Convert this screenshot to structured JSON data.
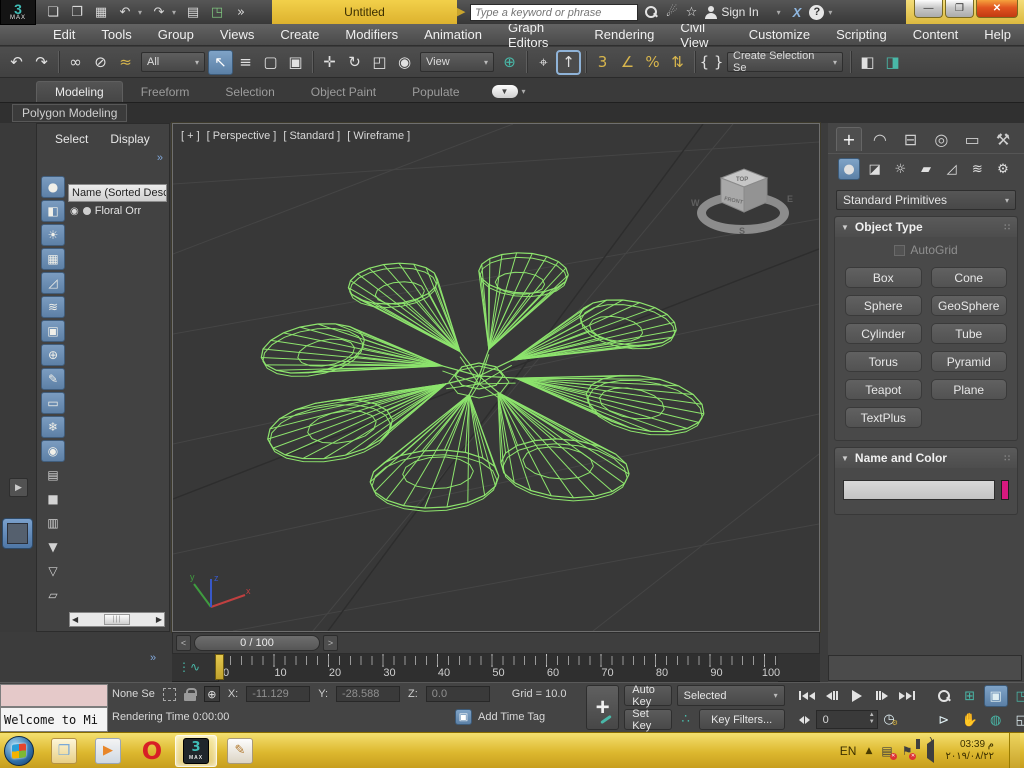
{
  "window": {
    "logo_text": "3",
    "logo_sub": "MAX",
    "title": "Untitled",
    "search_placeholder": "Type a keyword or phrase",
    "sign_in_label": "Sign In",
    "exchange_label": "X",
    "help_label": "?",
    "min_glyph": "—",
    "restore_glyph": "❐",
    "close_glyph": "✕",
    "quick_access": [
      {
        "name": "new-file-icon",
        "glyph": "❏"
      },
      {
        "name": "open-file-icon",
        "glyph": "❐"
      },
      {
        "name": "save-file-icon",
        "glyph": "▦"
      },
      {
        "name": "undo-icon",
        "glyph": "↶",
        "caret": true
      },
      {
        "name": "redo-icon",
        "glyph": "↷",
        "caret": true
      },
      {
        "name": "project-folder-icon",
        "glyph": "▤"
      },
      {
        "name": "workspace-icon",
        "glyph": "◳",
        "green": true
      },
      {
        "name": "overflow-icon",
        "glyph": "»"
      }
    ]
  },
  "menu_bar": {
    "items": [
      "Edit",
      "Tools",
      "Group",
      "Views",
      "Create",
      "Modifiers",
      "Animation",
      "Graph Editors",
      "Rendering",
      "Civil View",
      "Customize",
      "Scripting",
      "Content",
      "Help"
    ]
  },
  "toolbar": {
    "selection_filter_value": "All",
    "reference_coord_value": "View",
    "named_selection_value": "Create Selection Se",
    "groups": {
      "history": [
        {
          "name": "undo-icon",
          "glyph": "↶"
        },
        {
          "name": "redo-icon",
          "glyph": "↷"
        }
      ],
      "linking": [
        {
          "name": "select-and-link-icon",
          "glyph": "∞"
        },
        {
          "name": "unlink-selection-icon",
          "glyph": "⊘"
        },
        {
          "name": "bind-to-spacewarp-icon",
          "glyph": "≈",
          "gold": true
        }
      ],
      "selection": [
        {
          "name": "select-object-icon",
          "glyph": "↖",
          "active": true
        },
        {
          "name": "select-by-name-icon",
          "glyph": "≡"
        },
        {
          "name": "rectangular-selection-region-icon",
          "glyph": "▢"
        },
        {
          "name": "window-crossing-icon",
          "glyph": "▣"
        }
      ],
      "transform": [
        {
          "name": "select-and-move-icon",
          "glyph": "✛"
        },
        {
          "name": "select-and-rotate-icon",
          "glyph": "↻"
        },
        {
          "name": "select-and-scale-icon",
          "glyph": "◰"
        },
        {
          "name": "select-and-place-icon",
          "glyph": "◉"
        }
      ],
      "pivot": [
        {
          "name": "use-pivot-point-center-icon",
          "glyph": "⊕",
          "teal": true
        }
      ],
      "manipulate": [
        {
          "name": "select-and-manipulate-icon",
          "glyph": "⌖"
        },
        {
          "name": "keyboard-shortcut-override-icon",
          "glyph": "↑",
          "outlined": true
        }
      ],
      "snaps": [
        {
          "name": "snaps-toggle-3d-icon",
          "glyph": "3",
          "gold": true
        },
        {
          "name": "angle-snap-icon",
          "glyph": "∠",
          "gold": true
        },
        {
          "name": "percent-snap-icon",
          "glyph": "%",
          "gold": true
        },
        {
          "name": "spinner-snap-icon",
          "glyph": "⇅",
          "gold": true
        }
      ],
      "named_sets": [
        {
          "name": "edit-named-selection-sets-icon",
          "glyph": "{ }"
        }
      ],
      "mirror_align": [
        {
          "name": "mirror-icon",
          "glyph": "◧"
        },
        {
          "name": "align-icon",
          "glyph": "◨",
          "teal": true
        }
      ]
    }
  },
  "ribbon": {
    "tabs": [
      "Modeling",
      "Freeform",
      "Selection",
      "Object Paint",
      "Populate"
    ],
    "active_tab": "Modeling",
    "panel_label": "Polygon Modeling",
    "collapse_glyph": "▼",
    "collapse_caret": "▾"
  },
  "scene_explorer": {
    "menu_items": [
      "Select",
      "Display"
    ],
    "overflow_glyph": "»",
    "column_header": "Name (Sorted Desce",
    "rows": [
      {
        "name": "Floral Orr"
      }
    ],
    "filter_icons": [
      {
        "name": "display-geometry-icon",
        "glyph": "●",
        "active": true
      },
      {
        "name": "display-shapes-icon",
        "glyph": "◧",
        "active": true
      },
      {
        "name": "display-lights-icon",
        "glyph": "☀",
        "active": true
      },
      {
        "name": "display-cameras-icon",
        "glyph": "▦",
        "active": true
      },
      {
        "name": "display-helpers-icon",
        "glyph": "◿",
        "active": true
      },
      {
        "name": "display-spacewarps-icon",
        "glyph": "≋",
        "active": true
      },
      {
        "name": "display-groups-icon",
        "glyph": "▣",
        "active": true
      },
      {
        "name": "display-xrefs-icon",
        "glyph": "⊕",
        "active": true
      },
      {
        "name": "display-bones-icon",
        "glyph": "✎",
        "active": true
      },
      {
        "name": "display-containers-icon",
        "glyph": "▭",
        "active": true
      },
      {
        "name": "display-frozen-icon",
        "glyph": "❄",
        "active": true
      },
      {
        "name": "display-hidden-icon",
        "glyph": "◉",
        "active": true
      },
      {
        "name": "sort-list-icon",
        "glyph": "▤",
        "active": false
      },
      {
        "name": "blank-filter-icon",
        "glyph": "■",
        "active": false
      },
      {
        "name": "properties-list-icon",
        "glyph": "▥",
        "active": false
      },
      {
        "name": "filter-config-icon",
        "glyph": "▼",
        "active": false
      },
      {
        "name": "filter-funnel-icon",
        "glyph": "▽",
        "active": false
      },
      {
        "name": "new-container-icon",
        "glyph": "▱",
        "active": false
      }
    ]
  },
  "viewport": {
    "labels": {
      "plus": "[ + ]",
      "view": "[ Perspective ]",
      "render_preset": "[ Standard ]",
      "shading": "[ Wireframe ]"
    },
    "viewcube": {
      "top": "TOP",
      "front": "FRONT",
      "west": "W",
      "south": "S",
      "east": "E"
    },
    "axis_labels": {
      "x": "x",
      "y": "y",
      "z": "z"
    },
    "wireframe_color": "#8de46d"
  },
  "command_panel": {
    "tabs": [
      {
        "name": "create-tab",
        "glyph": "+",
        "active": true
      },
      {
        "name": "modify-tab",
        "glyph": "◠",
        "active": false
      },
      {
        "name": "hierarchy-tab",
        "glyph": "⊟",
        "active": false
      },
      {
        "name": "motion-tab",
        "glyph": "◎",
        "active": false
      },
      {
        "name": "display-tab",
        "glyph": "▭",
        "active": false
      },
      {
        "name": "utilities-tab",
        "glyph": "⚒",
        "active": false
      }
    ],
    "categories": [
      {
        "name": "geometry-category",
        "glyph": "●",
        "active": true
      },
      {
        "name": "shapes-category",
        "glyph": "◪",
        "active": false
      },
      {
        "name": "lights-category",
        "glyph": "☼",
        "active": false
      },
      {
        "name": "cameras-category",
        "glyph": "▰",
        "active": false
      },
      {
        "name": "helpers-category",
        "glyph": "◿",
        "active": false
      },
      {
        "name": "spacewarps-category",
        "glyph": "≋",
        "active": false
      },
      {
        "name": "systems-category",
        "glyph": "⚙",
        "active": false
      }
    ],
    "category_dropdown": "Standard Primitives",
    "rollouts": {
      "object_type": {
        "title": "Object Type",
        "autogrid_label": "AutoGrid",
        "buttons": [
          "Box",
          "Cone",
          "Sphere",
          "GeoSphere",
          "Cylinder",
          "Tube",
          "Torus",
          "Pyramid",
          "Teapot",
          "Plane",
          "TextPlus"
        ]
      },
      "name_and_color": {
        "title": "Name and Color",
        "name_value": "",
        "color_swatch": "#d6197f"
      }
    }
  },
  "time_controls": {
    "time_slider_value": "0 / 100",
    "prev_glyph": "<",
    "next_glyph": ">",
    "track_ticks": [
      "0",
      "10",
      "20",
      "30",
      "40",
      "50",
      "60",
      "70",
      "80",
      "90",
      "100"
    ],
    "current_frame": "0"
  },
  "status_bar": {
    "mini_listener_text": "Welcome to Mi",
    "selection_prompt": "None Se",
    "coords": {
      "x_label": "X:",
      "x": "-11.129",
      "y_label": "Y:",
      "y": "-28.588",
      "z_label": "Z:",
      "z": "0.0"
    },
    "grid_label": "Grid = 10.0",
    "rendering_time_label": "Rendering Time  0:00:00",
    "add_time_tag_label": "Add Time Tag",
    "animation": {
      "auto_key": "Auto Key",
      "set_key": "Set Key",
      "selection_scope": "Selected",
      "key_filters": "Key Filters..."
    }
  },
  "taskbar": {
    "language": "EN",
    "clock_time": "03:39 م",
    "clock_date": "٢٠١٩/٠٨/٢٢",
    "apps": [
      {
        "name": "taskbar-start-button",
        "kind": "start"
      },
      {
        "name": "taskbar-explorer-icon",
        "kind": "explorer",
        "glyph": "❒"
      },
      {
        "name": "taskbar-mediaplayer-icon",
        "kind": "wmp",
        "glyph": "▶"
      },
      {
        "name": "taskbar-opera-icon",
        "kind": "opera",
        "glyph": "O"
      },
      {
        "name": "taskbar-3dsmax-icon",
        "kind": "max",
        "glyph": "3",
        "sub": "MAX",
        "active": true
      },
      {
        "name": "taskbar-paint-icon",
        "kind": "paint",
        "glyph": "✎"
      }
    ]
  }
}
